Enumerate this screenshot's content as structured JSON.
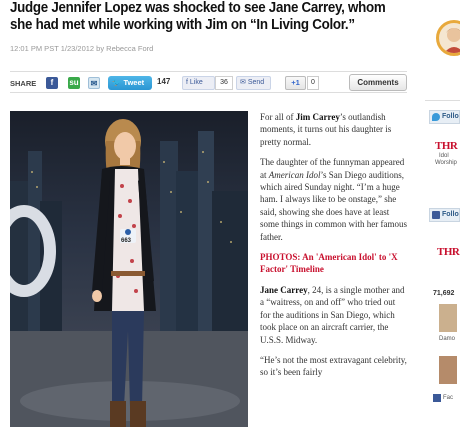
{
  "headline": {
    "dek": "Judge Jennifer Lopez was shocked to see Jane Carrey, whom she had met while working with Jim on “In Living Color.”"
  },
  "byline": "12:01 PM PST 1/23/2012 by Rebecca Ford",
  "share": {
    "label": "SHARE",
    "tweet_label": "Tweet",
    "tweet_count": "147",
    "like_label": "Like",
    "like_count": "36",
    "send_label": "Send",
    "gplus_label": "+1",
    "gplus_count": "0",
    "comments_label": "Comments"
  },
  "article": {
    "p1_name": "Jim Carrey",
    "p1_pre": "For all of ",
    "p1_post": "’s outlandish moments, it turns out his daughter is pretty normal.",
    "p2_pre": "The daughter of the funnyman appeared at ",
    "p2_show": "American Idol",
    "p2_post": "’s San Diego auditions, which aired Sunday night. “I’m a huge ham. I always like to be onstage,” she said, showing she does have at least some things in common with her famous father.",
    "photos_link": "PHOTOS: An 'American Idol' to 'X Factor' Timeline",
    "p3_name": "Jane Carrey",
    "p3_post": ", 24, is a single mother and a “waitress, on and off” who tried out for the auditions in San Diego, which took place on an aircraft carrier, the U.S.S. Midway.",
    "p4": "“He’s not the most extravagant celebrity, so it’s been fairly"
  },
  "photo": {
    "badge_number": "663"
  },
  "sidebar": {
    "follow1": "Follo",
    "thr_logo": "THR",
    "thr_sub": "Idol",
    "thr_sub2": "Worship",
    "follow2": "Follo",
    "thr_logo2": "THR",
    "count": "71,692",
    "name_snippet": "Damo",
    "fb_snippet": "Fac"
  },
  "colors": {
    "accent_red": "#c8102e",
    "twitter_blue": "#2a96d3",
    "facebook_blue": "#3b5998"
  }
}
